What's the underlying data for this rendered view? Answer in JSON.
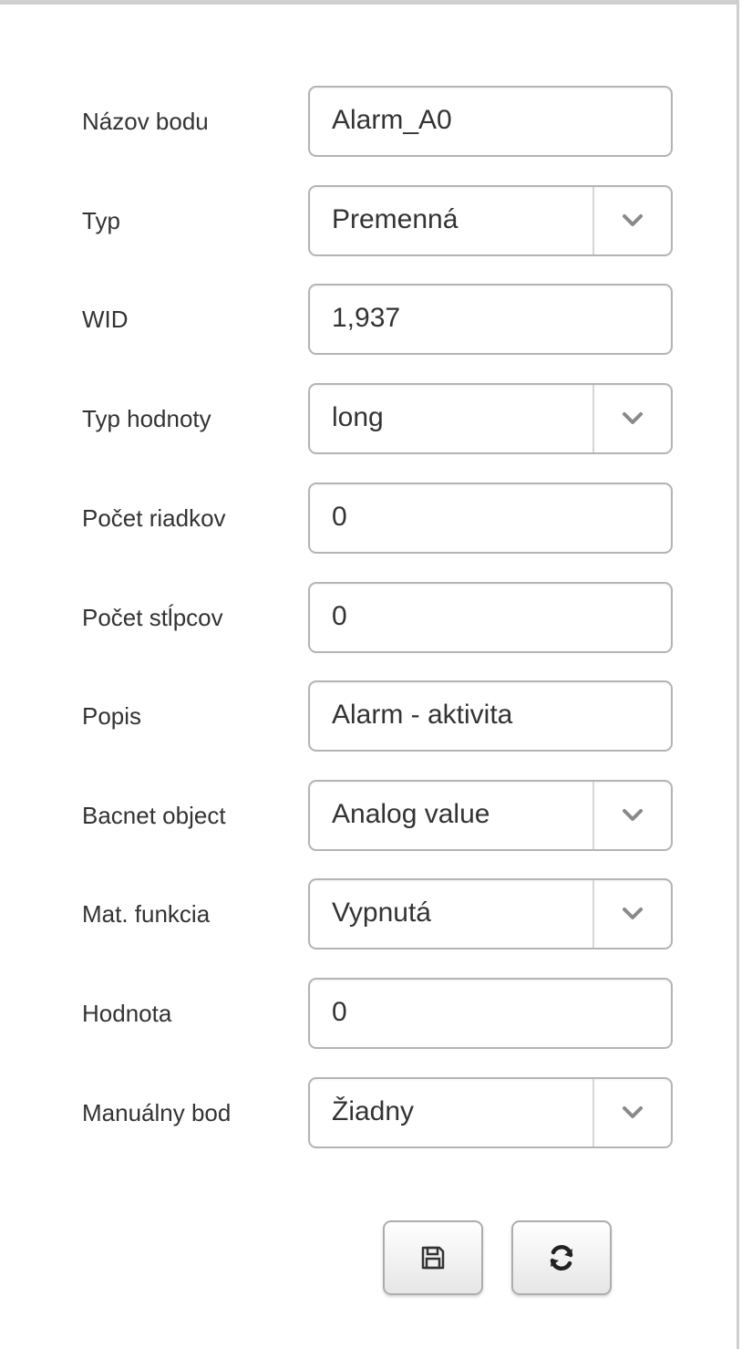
{
  "form": {
    "fields": [
      {
        "label": "Názov bodu",
        "value": "Alarm_A0",
        "kind": "input"
      },
      {
        "label": "Typ",
        "value": "Premenná",
        "kind": "select"
      },
      {
        "label": "WID",
        "value": "1,937",
        "kind": "input"
      },
      {
        "label": "Typ hodnoty",
        "value": "long",
        "kind": "select"
      },
      {
        "label": "Počet riadkov",
        "value": "0",
        "kind": "input"
      },
      {
        "label": "Počet stĺpcov",
        "value": "0",
        "kind": "input"
      },
      {
        "label": "Popis",
        "value": "Alarm - aktivita",
        "kind": "input"
      },
      {
        "label": "Bacnet object",
        "value": "Analog value",
        "kind": "select"
      },
      {
        "label": "Mat. funkcia",
        "value": "Vypnutá",
        "kind": "select"
      },
      {
        "label": "Hodnota",
        "value": "0",
        "kind": "input"
      },
      {
        "label": "Manuálny bod",
        "value": "Žiadny",
        "kind": "select"
      }
    ]
  },
  "buttons": {
    "save_icon": "save-icon",
    "refresh_icon": "refresh-icon"
  },
  "colors": {
    "border": "#b4b4b4",
    "text": "#333333",
    "panel_border": "#cfcfcf"
  }
}
